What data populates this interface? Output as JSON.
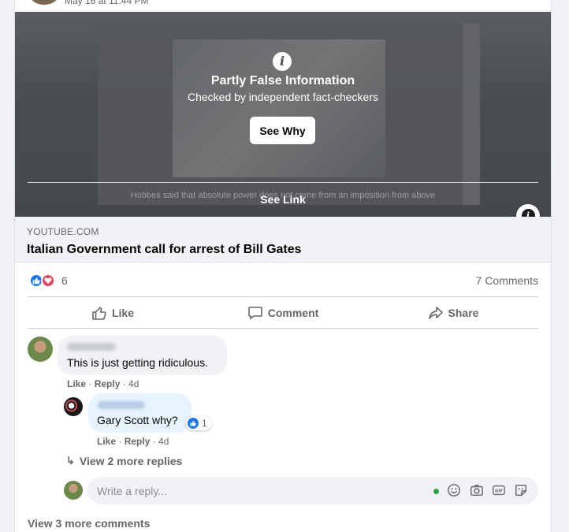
{
  "post_header": {
    "timestamp": "May 16 at 11:44 PM"
  },
  "fact_check": {
    "title": "Partly False Information",
    "subtitle": "Checked by independent fact-checkers",
    "see_why_label": "See Why",
    "see_link_label": "See Link",
    "blurred_caption": "Hobbes said that absolute power does not come from an imposition from above"
  },
  "link_preview": {
    "domain": "YOUTUBE.COM",
    "title": "Italian Government call for arrest of Bill Gates"
  },
  "reactions": {
    "count": "6",
    "types": [
      "like-icon",
      "love-icon"
    ]
  },
  "comments_count_label": "7 Comments",
  "actions": {
    "like": "Like",
    "comment": "Comment",
    "share": "Share"
  },
  "comments": [
    {
      "text": "This is just getting ridiculous.",
      "meta": {
        "like": "Like",
        "reply": "Reply",
        "age": "4d"
      },
      "replies": [
        {
          "mention": "Gary Scott",
          "text": " why?",
          "reaction_count": "1",
          "meta": {
            "like": "Like",
            "reply": "Reply",
            "age": "4d"
          }
        }
      ],
      "more_replies_label": "View 2 more replies"
    }
  ],
  "reply_input": {
    "placeholder": "Write a reply..."
  },
  "view_more_comments_label": "View 3 more comments",
  "colors": {
    "accent": "#1877f2",
    "love": "#f33e58",
    "online": "#31a24c"
  }
}
